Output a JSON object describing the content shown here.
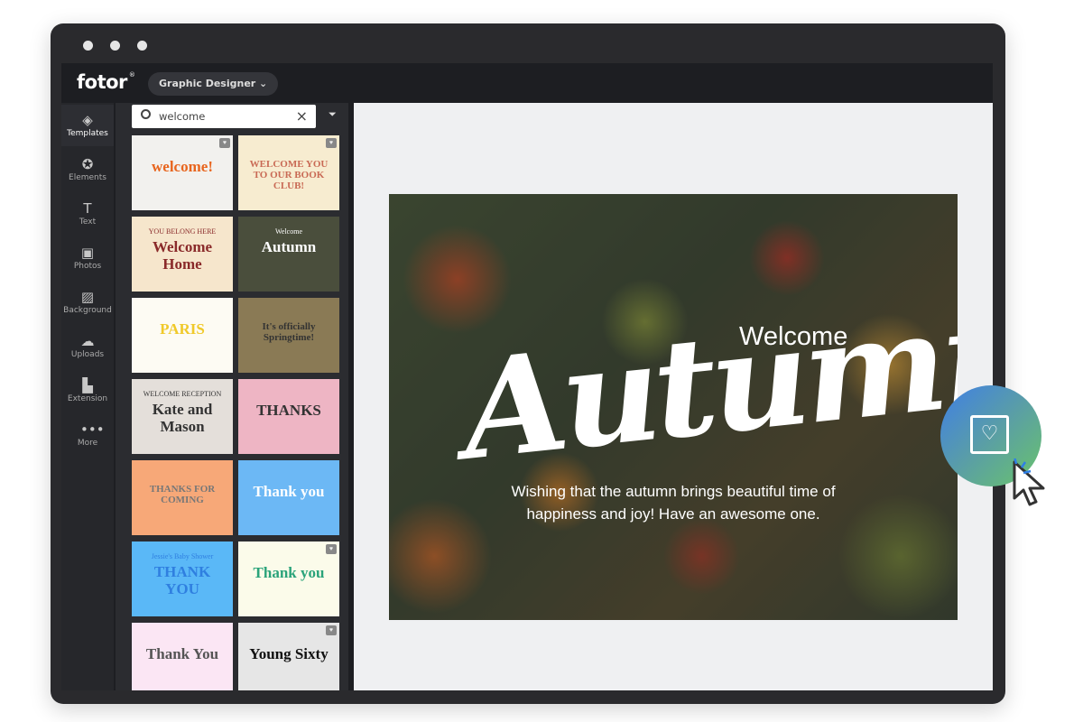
{
  "app": {
    "logo": "fotor",
    "logo_mark": "®",
    "mode": "Graphic Designer"
  },
  "sidebar": {
    "items": [
      {
        "label": "Templates",
        "icon": "layers-icon",
        "glyph": "◈",
        "active": true
      },
      {
        "label": "Elements",
        "icon": "star-circle-icon",
        "glyph": "✪"
      },
      {
        "label": "Text",
        "icon": "text-icon",
        "glyph": "T"
      },
      {
        "label": "Photos",
        "icon": "photo-icon",
        "glyph": "▣"
      },
      {
        "label": "Background",
        "icon": "background-icon",
        "glyph": "▨"
      },
      {
        "label": "Uploads",
        "icon": "cloud-upload-icon",
        "glyph": "☁"
      },
      {
        "label": "Extension",
        "icon": "extension-icon",
        "glyph": "▙"
      },
      {
        "label": "More",
        "icon": "more-icon",
        "glyph": "•••"
      }
    ]
  },
  "search": {
    "value": "welcome"
  },
  "templates": [
    {
      "text": "welcome!",
      "bg": "#f2f1ee",
      "fg": "#e8651e",
      "fav": true
    },
    {
      "text": "WELCOME YOU TO OUR BOOK CLUB!",
      "bg": "#f7ecd0",
      "fg": "#c96a55",
      "fav": true
    },
    {
      "text": "Welcome Home",
      "sub": "YOU BELONG HERE",
      "bg": "#f6e6cc",
      "fg": "#8a2a2a"
    },
    {
      "text": "Autumn",
      "sub": "Welcome",
      "bg": "#4a4e3c",
      "fg": "#ffffff"
    },
    {
      "text": "PARIS",
      "bg": "#fdfbf3",
      "fg": "#f0c92a"
    },
    {
      "text": "It's officially Springtime!",
      "bg": "#8a7a55",
      "fg": "#333333"
    },
    {
      "text": "Kate and Mason",
      "sub": "WELCOME RECEPTION",
      "bg": "#e4dfda",
      "fg": "#333333"
    },
    {
      "text": "THANKS",
      "bg": "#eeb5c4",
      "fg": "#333333"
    },
    {
      "text": "THANKS FOR COMING",
      "bg": "#f7a878",
      "fg": "#777777"
    },
    {
      "text": "Thank you",
      "bg": "#6cb8f5",
      "fg": "#ffffff"
    },
    {
      "text": "THANK YOU",
      "sub": "Jessie's Baby Shower",
      "bg": "#5ab8f7",
      "fg": "#2f7fe0"
    },
    {
      "text": "Thank you",
      "bg": "#fbfbea",
      "fg": "#2aa37a",
      "fav": true
    },
    {
      "text": "Thank You",
      "bg": "#fbe6f4",
      "fg": "#555555"
    },
    {
      "text": "Young Sixty",
      "bg": "#e6e6e6",
      "fg": "#111111",
      "fav": true
    }
  ],
  "canvas": {
    "welcome": "Welcome",
    "title": "Autumn",
    "message": "Wishing that the autumn brings beautiful time of happiness and joy! Have an awesome one."
  },
  "fab": {
    "icon": "favorite-frame-icon"
  }
}
